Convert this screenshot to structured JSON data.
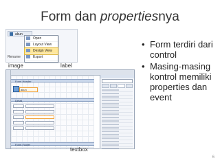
{
  "title": {
    "main": "Form dan ",
    "emphasis": "properties",
    "suffix": "nya"
  },
  "context_menu": {
    "tab_label": "akun",
    "items": [
      "Open",
      "Layout View",
      "Design View",
      "Export",
      "Rename"
    ],
    "selected_index": 2
  },
  "labels": {
    "image": "image",
    "label": "label",
    "textbox": "textbox"
  },
  "design_view": {
    "sections": [
      "Form Header",
      "Detail",
      "Form Footer"
    ],
    "label_control_text": "akun"
  },
  "bullets": [
    "Form terdiri dari control",
    "Masing-masing kontrol memiliki properties dan event"
  ],
  "page_number": "6"
}
